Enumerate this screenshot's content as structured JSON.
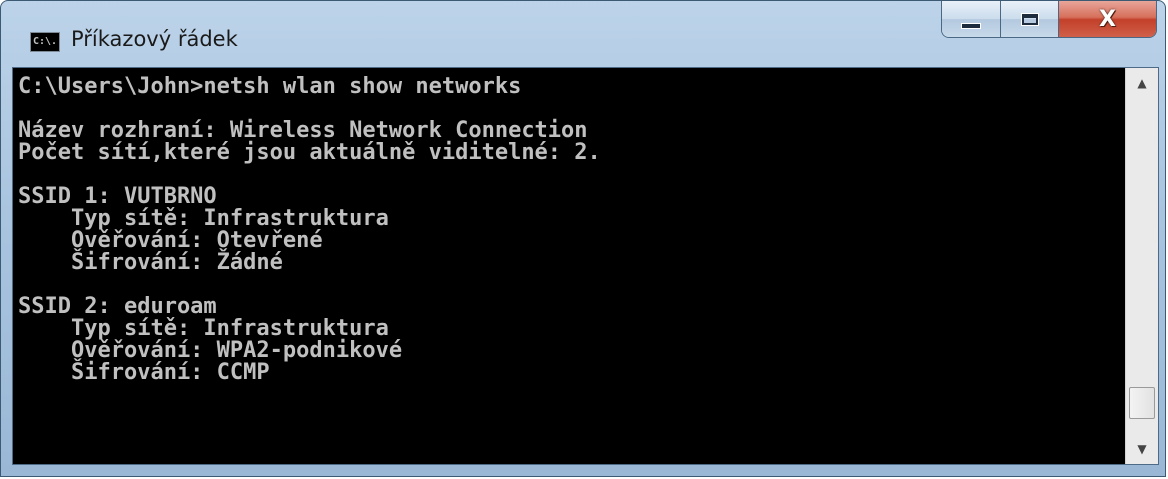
{
  "window": {
    "title": "Příkazový řádek",
    "icon_label": "C:\\.",
    "buttons": {
      "minimize_icon": "minimize-icon",
      "maximize_icon": "maximize-icon",
      "close_glyph": "X"
    }
  },
  "console": {
    "lines": [
      "C:\\Users\\John>netsh wlan show networks",
      "",
      "Název rozhraní: Wireless Network Connection",
      "Počet sítí,které jsou aktuálně viditelné: 2.",
      "",
      "SSID 1: VUTBRNO",
      "    Typ sítě: Infrastruktura",
      "    Ověřování: Otevřené",
      "    Šifrování: Žádné",
      "",
      "SSID 2: eduroam",
      "    Typ sítě: Infrastruktura",
      "    Ověřování: WPA2-podnikové",
      "    Šifrování: CCMP"
    ],
    "scroll_position": 0.95
  },
  "colors": {
    "console_background": "#000000",
    "console_text": "#c0c0c0",
    "close_button": "#c3402a"
  }
}
